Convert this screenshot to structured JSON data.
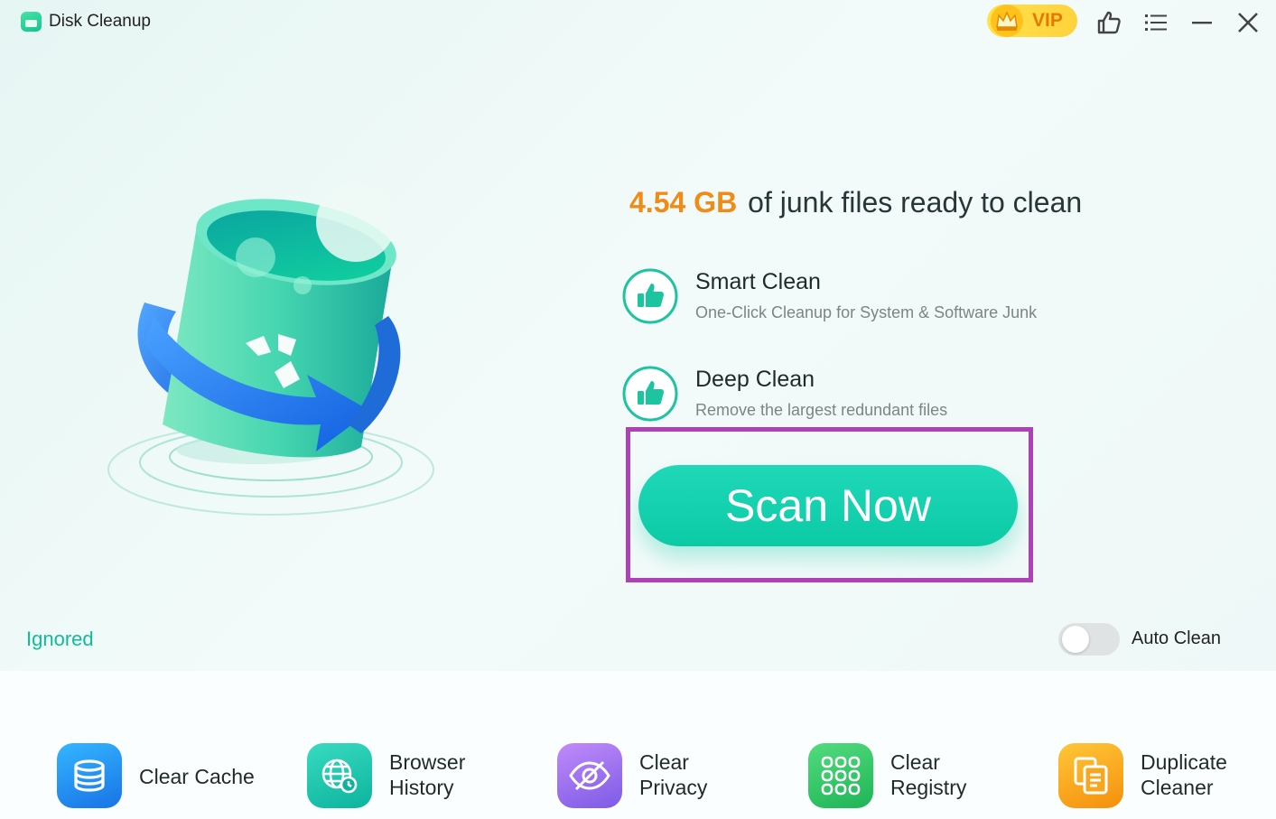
{
  "window": {
    "title": "Disk Cleanup"
  },
  "toolbar": {
    "vip_label": "VIP"
  },
  "summary": {
    "size": "4.54 GB",
    "text": "of junk files ready to clean"
  },
  "features": [
    {
      "title": "Smart Clean",
      "description": "One-Click Cleanup for System & Software Junk"
    },
    {
      "title": "Deep Clean",
      "description": "Remove the largest redundant files"
    }
  ],
  "scan_button": {
    "label": "Scan Now"
  },
  "footer": {
    "ignored_label": "Ignored",
    "auto_clean_label": "Auto Clean",
    "auto_clean_enabled": false
  },
  "tools": [
    {
      "line1": "Clear Cache",
      "line2": "",
      "icon": "database-icon",
      "color": "#1f8fe8"
    },
    {
      "line1": "Browser",
      "line2": "History",
      "icon": "globe-clock-icon",
      "color": "#16c2a8"
    },
    {
      "line1": "Clear",
      "line2": "Privacy",
      "icon": "eye-off-icon",
      "color": "#9b6ee8"
    },
    {
      "line1": "Clear",
      "line2": "Registry",
      "icon": "grid-icon",
      "color": "#2fc46a"
    },
    {
      "line1": "Duplicate",
      "line2": "Cleaner",
      "icon": "copy-document-icon",
      "color": "#f5a418"
    }
  ]
}
